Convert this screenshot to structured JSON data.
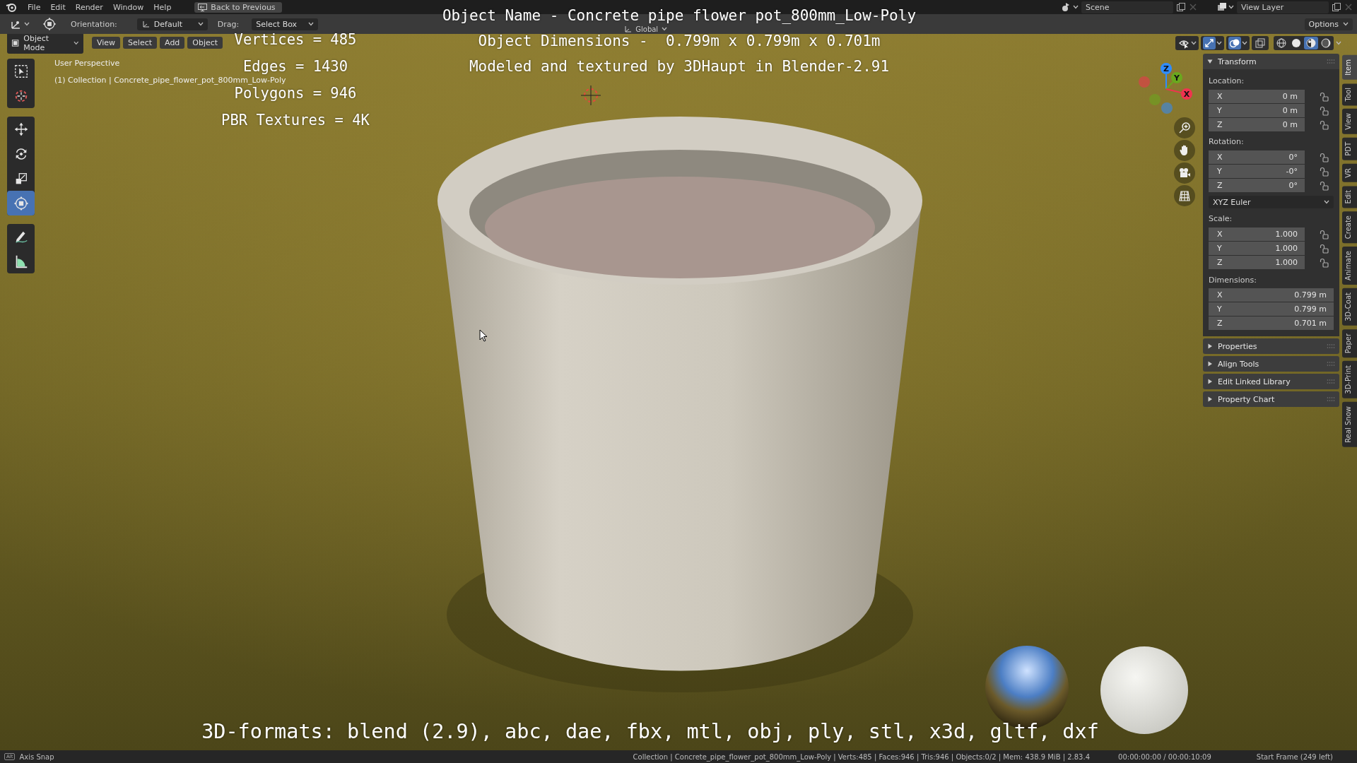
{
  "menu_bar": {
    "items": [
      "File",
      "Edit",
      "Render",
      "Window",
      "Help"
    ],
    "back_button": "Back to Previous",
    "scene": "Scene",
    "view_layer": "View Layer"
  },
  "tool_header": {
    "orientation_label": "Orientation:",
    "orientation": "Default",
    "drag_label": "Drag:",
    "drag": "Select Box",
    "transform_orientation": "Global",
    "options": "Options"
  },
  "viewport_header": {
    "mode": "Object Mode",
    "menus": [
      "View",
      "Select",
      "Add",
      "Object"
    ],
    "toggles": [
      {
        "kind": "selectability",
        "on": false
      },
      {
        "kind": "gizmo",
        "on": true
      },
      {
        "kind": "overlay",
        "on": true
      },
      {
        "kind": "xray",
        "on": false
      }
    ],
    "shading": [
      {
        "kind": "wireframe",
        "selected": false
      },
      {
        "kind": "solid",
        "selected": false
      },
      {
        "kind": "material",
        "selected": true
      },
      {
        "kind": "rendered",
        "selected": false
      }
    ]
  },
  "toolbar": [
    [
      {
        "kind": "select_box",
        "selected": false
      },
      {
        "kind": "cursor",
        "selected": false
      }
    ],
    [
      {
        "kind": "move",
        "selected": false
      },
      {
        "kind": "rotate",
        "selected": false
      },
      {
        "kind": "scale",
        "selected": false
      },
      {
        "kind": "transform",
        "selected": true
      }
    ],
    [
      {
        "kind": "annotate",
        "selected": false
      },
      {
        "kind": "measure",
        "selected": false
      }
    ]
  ],
  "viewport_info": [
    "User Perspective",
    "(1) Collection | Concrete_pipe_flower_pot_800mm_Low-Poly"
  ],
  "stats_overlay": [
    "Vertices = 485",
    "Edges = 1430",
    "Polygons = 946",
    "PBR Textures = 4K"
  ],
  "title_overlay": [
    "Object Name - Concrete pipe flower pot_800mm_Low-Poly",
    "Object Dimensions -  0.799m x 0.799m x 0.701m",
    "Modeled and textured by 3DHaupt in Blender-2.91"
  ],
  "formats_overlay": "3D-formats: blend (2.9), abc, dae, fbx, mtl, obj, ply, stl, x3d, gltf, dxf",
  "gizmo": {
    "axes": [
      {
        "label": "Z",
        "color": "#2f8cff"
      },
      {
        "label": "Y",
        "color": "#6aa81e"
      },
      {
        "label": "X",
        "color": "#f0334f"
      }
    ]
  },
  "sidebar": {
    "tabs": [
      {
        "label": "Item",
        "selected": true
      },
      {
        "label": "Tool",
        "selected": false
      },
      {
        "label": "View",
        "selected": false
      },
      {
        "label": "PDT",
        "selected": false
      },
      {
        "label": "VR",
        "selected": false
      },
      {
        "label": "Edit",
        "selected": false
      },
      {
        "label": "Create",
        "selected": false
      },
      {
        "label": "Animate",
        "selected": false
      },
      {
        "label": "3D-Coat",
        "selected": false
      },
      {
        "label": "Paper",
        "selected": false
      },
      {
        "label": "3D-Print",
        "selected": false
      },
      {
        "label": "Real Snow",
        "selected": false
      }
    ],
    "transform": {
      "title": "Transform",
      "expanded": true,
      "location": {
        "label": "Location:",
        "fields": [
          {
            "axis": "X",
            "value": "0 m",
            "locked": false
          },
          {
            "axis": "Y",
            "value": "0 m",
            "locked": false
          },
          {
            "axis": "Z",
            "value": "0 m",
            "locked": false
          }
        ]
      },
      "rotation": {
        "label": "Rotation:",
        "fields": [
          {
            "axis": "X",
            "value": "0°",
            "locked": false
          },
          {
            "axis": "Y",
            "value": "-0°",
            "locked": false
          },
          {
            "axis": "Z",
            "value": "0°",
            "locked": false
          }
        ]
      },
      "rotation_mode": "XYZ Euler",
      "scale": {
        "label": "Scale:",
        "fields": [
          {
            "axis": "X",
            "value": "1.000",
            "locked": false
          },
          {
            "axis": "Y",
            "value": "1.000",
            "locked": false
          },
          {
            "axis": "Z",
            "value": "1.000",
            "locked": false
          }
        ]
      },
      "dimensions": {
        "label": "Dimensions:",
        "fields": [
          {
            "axis": "X",
            "value": "0.799 m"
          },
          {
            "axis": "Y",
            "value": "0.799 m"
          },
          {
            "axis": "Z",
            "value": "0.701 m"
          }
        ]
      }
    },
    "panels": [
      {
        "title": "Properties",
        "expanded": false
      },
      {
        "title": "Align Tools",
        "expanded": false
      },
      {
        "title": "Edit Linked Library",
        "expanded": false
      },
      {
        "title": "Property Chart",
        "expanded": false
      }
    ]
  },
  "status_bar": {
    "key": "Alt",
    "hint": "Axis Snap",
    "stats": "Collection | Concrete_pipe_flower_pot_800mm_Low-Poly | Verts:485 | Faces:946 | Tris:946 | Objects:0/2 | Mem: 438.9 MiB | 2.83.4",
    "time": "00:00:00:00 / 00:00:10:09",
    "frame": "Start Frame (249 left)"
  }
}
